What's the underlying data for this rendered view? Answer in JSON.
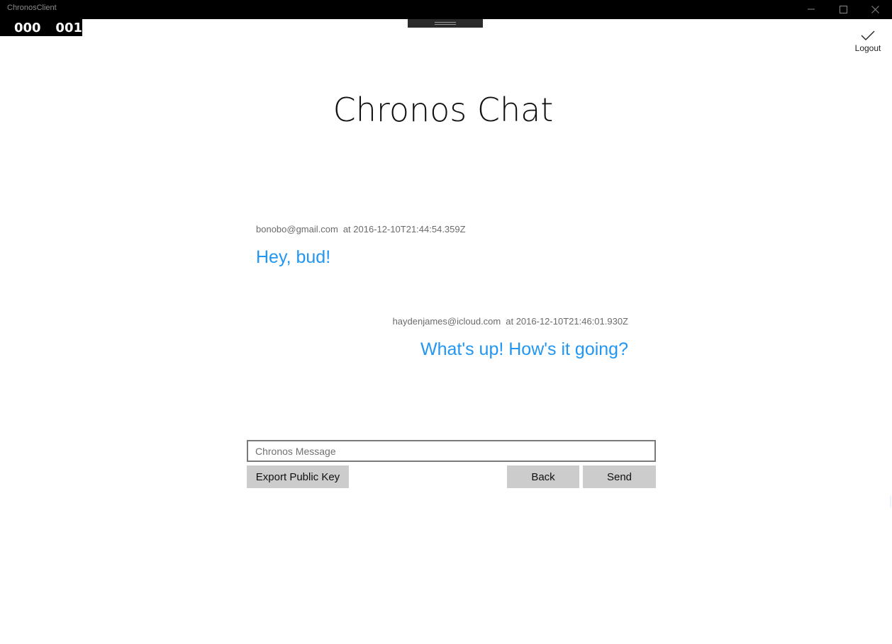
{
  "window": {
    "title": "ChronosClient",
    "controls": [
      "minimize-icon",
      "maximize-icon",
      "close-icon"
    ]
  },
  "frame_counter": {
    "a": "000",
    "b": "001"
  },
  "app_bar": {
    "logout_label": "Logout",
    "logout_icon": "checkmark-icon"
  },
  "page": {
    "title": "Chronos Chat"
  },
  "messages": [
    {
      "sender": "bonobo@gmail.com",
      "timestamp": "at 2016-12-10T21:44:54.359Z",
      "text": "Hey, bud!",
      "align": "left"
    },
    {
      "sender": "haydenjames@icloud.com",
      "timestamp": "at 2016-12-10T21:46:01.930Z",
      "text": "What's up! How's it going?",
      "align": "right"
    }
  ],
  "composer": {
    "placeholder": "Chronos Message",
    "value": "",
    "export_label": "Export Public Key",
    "back_label": "Back",
    "send_label": "Send"
  },
  "colors": {
    "titlebar": "#000000",
    "message_text": "#2196f3",
    "button_bg": "#cccccc",
    "meta_text": "#6b6b6b"
  }
}
